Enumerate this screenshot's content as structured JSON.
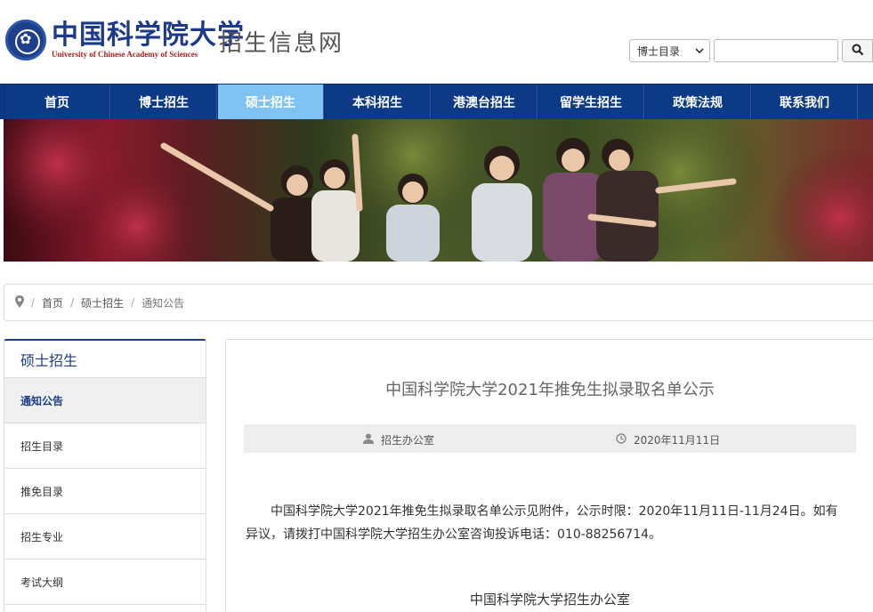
{
  "header": {
    "logo_cn": "中国科学院大学",
    "logo_en": "University of Chinese Academy of Sciences",
    "site_name": "招生信息网"
  },
  "search": {
    "select_value": "博士目录",
    "input_value": "",
    "button_icon": "search-icon"
  },
  "nav": {
    "items": [
      {
        "label": "首页"
      },
      {
        "label": "博士招生"
      },
      {
        "label": "硕士招生",
        "active": true
      },
      {
        "label": "本科招生"
      },
      {
        "label": "港澳台招生"
      },
      {
        "label": "留学生招生"
      },
      {
        "label": "政策法规"
      },
      {
        "label": "联系我们"
      }
    ]
  },
  "breadcrumb": {
    "icon": "location-pin-icon",
    "items": [
      "首页",
      "硕士招生",
      "通知公告"
    ]
  },
  "sidebar": {
    "title": "硕士招生",
    "items": [
      {
        "label": "通知公告",
        "active": true
      },
      {
        "label": "招生目录"
      },
      {
        "label": "推免目录"
      },
      {
        "label": "招生专业"
      },
      {
        "label": "考试大纲"
      }
    ]
  },
  "article": {
    "title": "中国科学院大学2021年推免生拟录取名单公示",
    "author": "招生办公室",
    "date": "2020年11月11日",
    "body": "中国科学院大学2021年推免生拟录取名单公示见附件，公示时限：2020年11月11日-11月24日。如有异议，请拨打中国科学院大学招生办公室咨询投诉电话：010-88256714。",
    "signature": "中国科学院大学招生办公室"
  },
  "colors": {
    "nav_bg": "#0c3a86",
    "nav_active": "#7ec3f2",
    "brand": "#1d3f8e"
  }
}
